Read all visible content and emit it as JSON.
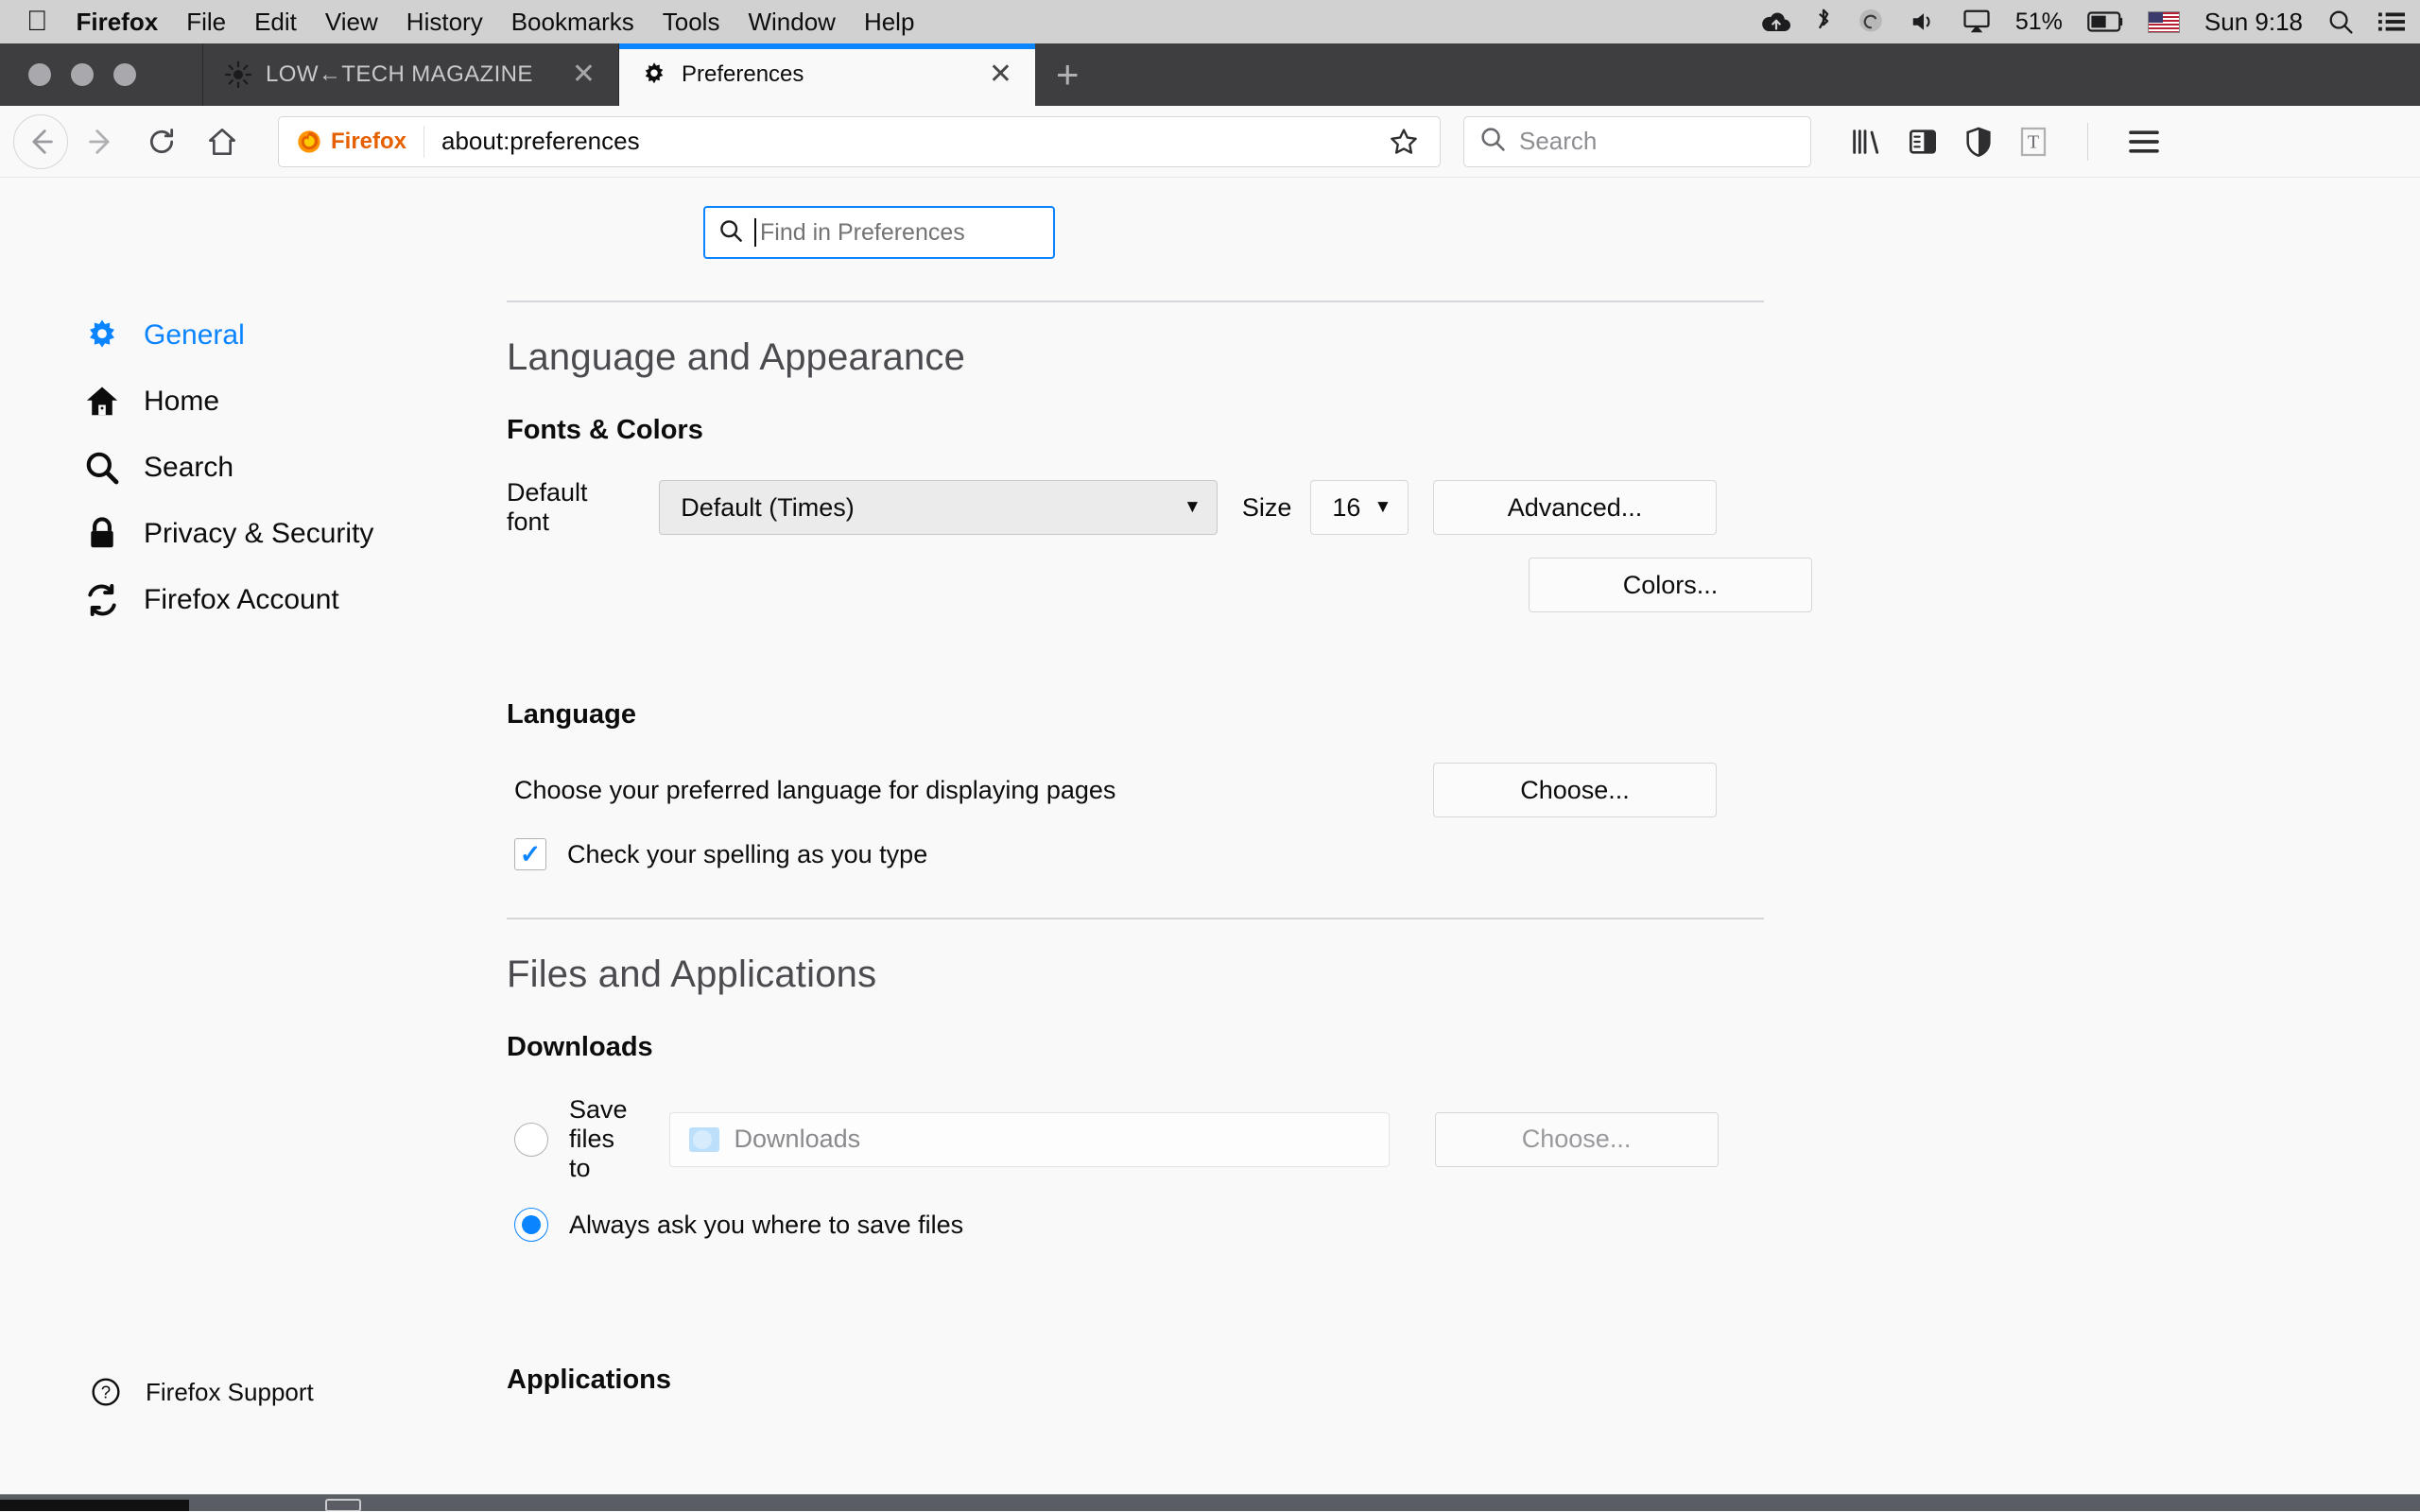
{
  "menubar": {
    "apple_icon": "apple-logo",
    "items": [
      "Firefox",
      "File",
      "Edit",
      "View",
      "History",
      "Bookmarks",
      "Tools",
      "Window",
      "Help"
    ],
    "status": {
      "cloud_icon": "cloud-upload-icon",
      "bluetooth_icon": "bluetooth-icon",
      "dropbox_icon": "circle-swirl-icon",
      "volume_icon": "volume-icon",
      "airplay_icon": "airplay-icon",
      "battery_percent": "51%",
      "battery_icon": "battery-icon",
      "flag_icon": "us-flag-icon",
      "clock": "Sun 9:18",
      "search_icon": "spotlight-search-icon",
      "list_icon": "notification-center-icon"
    }
  },
  "tabs": [
    {
      "title": "LOW←TECH MAGAZINE",
      "favicon": "sun-icon",
      "active": false,
      "close_label": "✕"
    },
    {
      "title": "Preferences",
      "favicon": "gear-icon",
      "active": true,
      "close_label": "✕"
    }
  ],
  "newtab_label": "+",
  "navbar": {
    "back_icon": "back-arrow-icon",
    "forward_icon": "forward-arrow-icon",
    "reload_icon": "reload-icon",
    "home_icon": "home-icon",
    "url_badge": "Firefox",
    "url": "about:preferences",
    "star_icon": "bookmark-star-icon",
    "search_placeholder": "Search",
    "search_icon": "search-icon",
    "library_icon": "library-icon",
    "sidebar_icon": "sidebar-toggle-icon",
    "shield_icon": "tracking-shield-icon",
    "reader_icon": "reader-mode-icon",
    "menu_icon": "hamburger-menu-icon"
  },
  "find": {
    "placeholder": "Find in Preferences",
    "icon": "search-icon",
    "focused": true
  },
  "sidebar": {
    "items": [
      {
        "label": "General",
        "icon": "gear-icon",
        "active": true
      },
      {
        "label": "Home",
        "icon": "home-icon",
        "active": false
      },
      {
        "label": "Search",
        "icon": "search-icon",
        "active": false
      },
      {
        "label": "Privacy & Security",
        "icon": "lock-icon",
        "active": false
      },
      {
        "label": "Firefox Account",
        "icon": "sync-icon",
        "active": false
      }
    ],
    "support": {
      "label": "Firefox Support",
      "icon": "help-circle-icon"
    }
  },
  "main": {
    "section_language": {
      "title": "Language and Appearance",
      "fonts_colors": {
        "heading": "Fonts & Colors",
        "default_font_label": "Default font",
        "default_font_value": "Default (Times)",
        "size_label": "Size",
        "size_value": "16",
        "advanced_button": "Advanced...",
        "colors_button": "Colors..."
      },
      "language": {
        "heading": "Language",
        "choose_text": "Choose your preferred language for displaying pages",
        "choose_button": "Choose...",
        "spellcheck_label": "Check your spelling as you type",
        "spellcheck_checked": true,
        "check_glyph": "✓"
      }
    },
    "section_files": {
      "title": "Files and Applications",
      "downloads": {
        "heading": "Downloads",
        "save_to_label": "Save files to",
        "save_to_selected": false,
        "folder_value": "Downloads",
        "folder_icon": "downloads-folder-icon",
        "choose_button": "Choose...",
        "always_ask_label": "Always ask you where to save files",
        "always_ask_selected": true
      },
      "applications_heading": "Applications"
    }
  },
  "colors": {
    "accent": "#0a84ff",
    "firefox_orange": "#e66000",
    "menubar_bg": "#d1d1d1",
    "tabbar_bg": "#3e3e40",
    "page_bg": "#f9f9fa"
  }
}
